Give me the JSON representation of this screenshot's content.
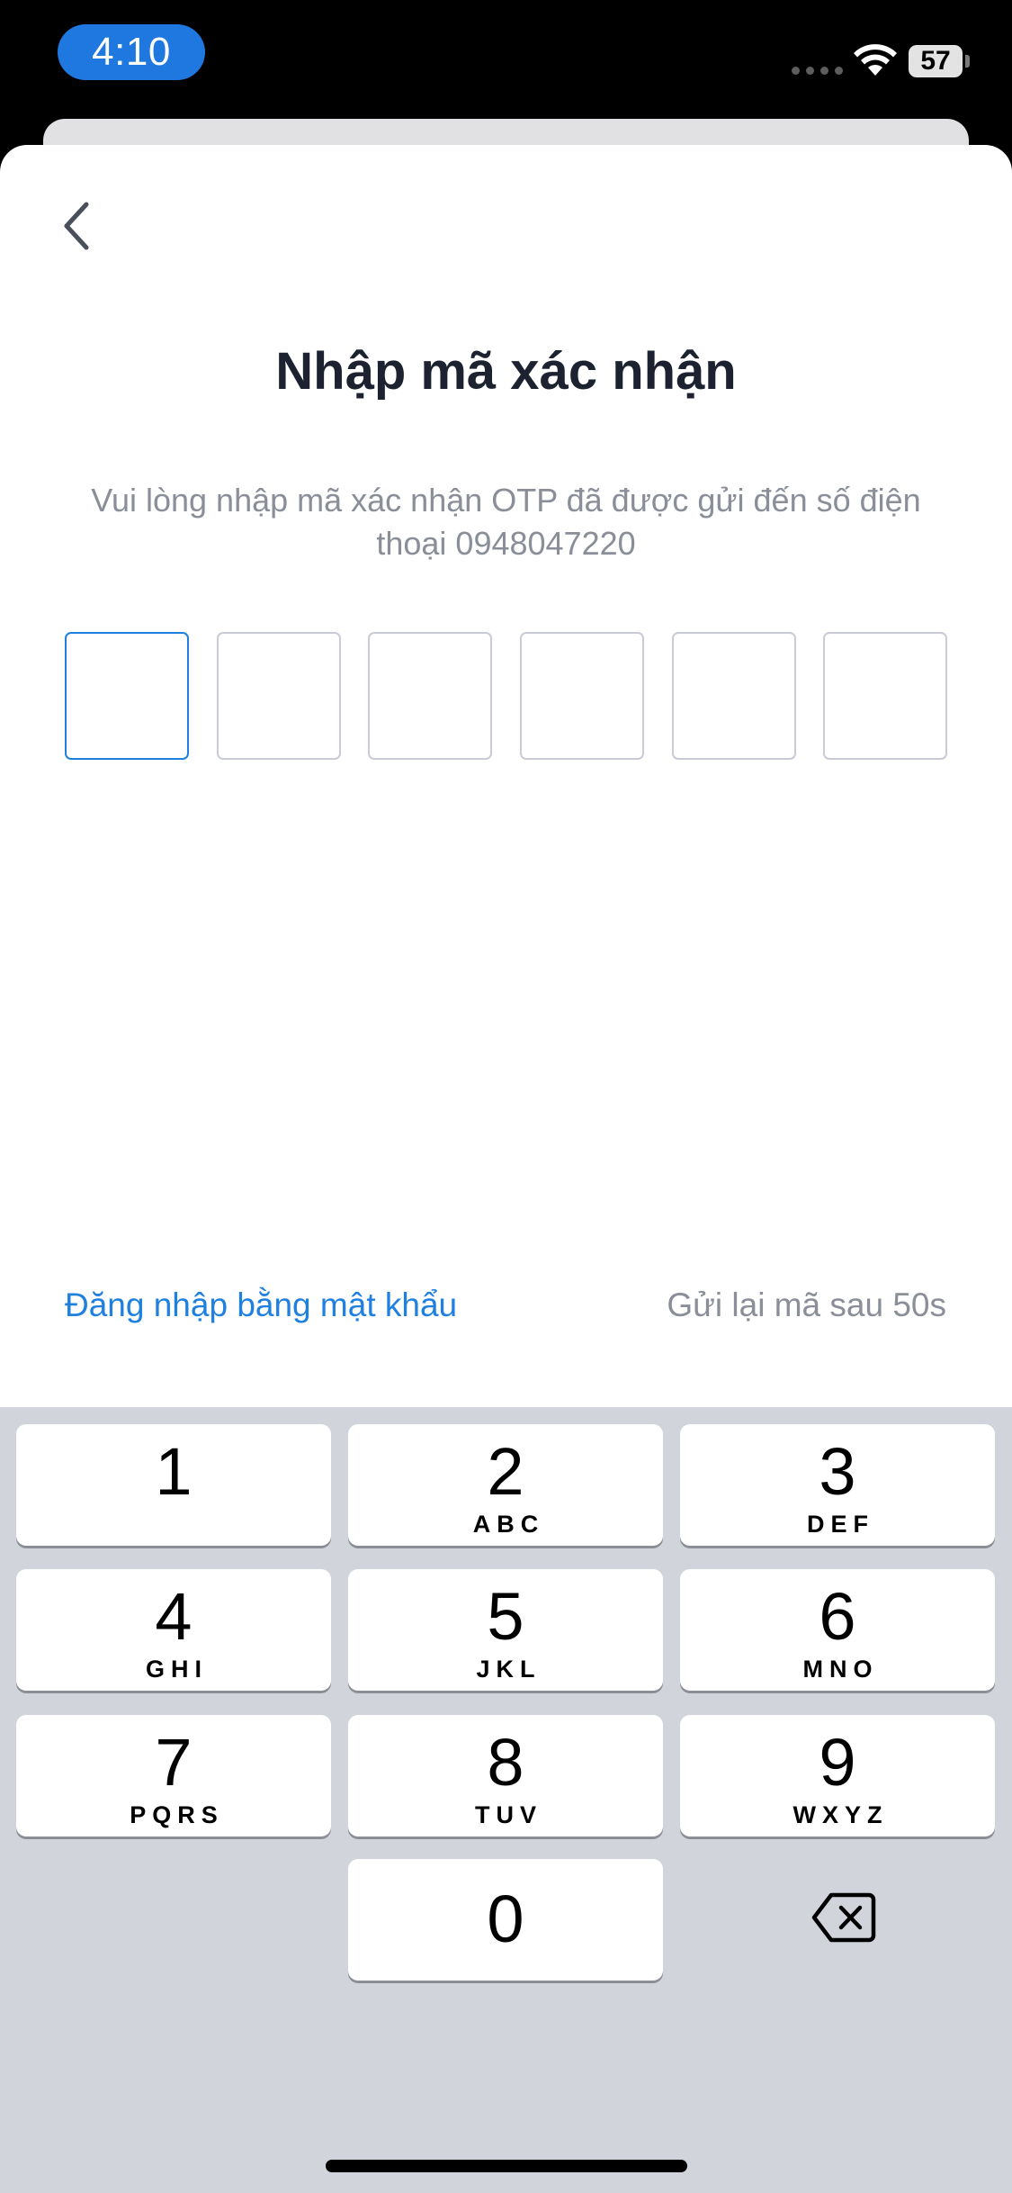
{
  "status_bar": {
    "time": "4:10",
    "battery": "57",
    "accent_color": "#1f78e0"
  },
  "screen": {
    "back_icon": "chevron-left-icon",
    "title": "Nhập mã xác nhận",
    "subtitle": "Vui lòng nhập mã xác nhận OTP đã được gửi đến số điện thoại 0948047220",
    "otp_length": 6,
    "otp_active_index": 0,
    "login_with_password": "Đăng nhập bằng mật khẩu",
    "resend_text": "Gửi lại mã sau 50s",
    "link_color": "#1f80e0"
  },
  "keyboard": {
    "keys": [
      {
        "digit": "1",
        "letters": ""
      },
      {
        "digit": "2",
        "letters": "ABC"
      },
      {
        "digit": "3",
        "letters": "DEF"
      },
      {
        "digit": "4",
        "letters": "GHI"
      },
      {
        "digit": "5",
        "letters": "JKL"
      },
      {
        "digit": "6",
        "letters": "MNO"
      },
      {
        "digit": "7",
        "letters": "PQRS"
      },
      {
        "digit": "8",
        "letters": "TUV"
      },
      {
        "digit": "9",
        "letters": "WXYZ"
      },
      {
        "digit": "0",
        "letters": ""
      }
    ],
    "delete_icon": "backspace-icon"
  }
}
